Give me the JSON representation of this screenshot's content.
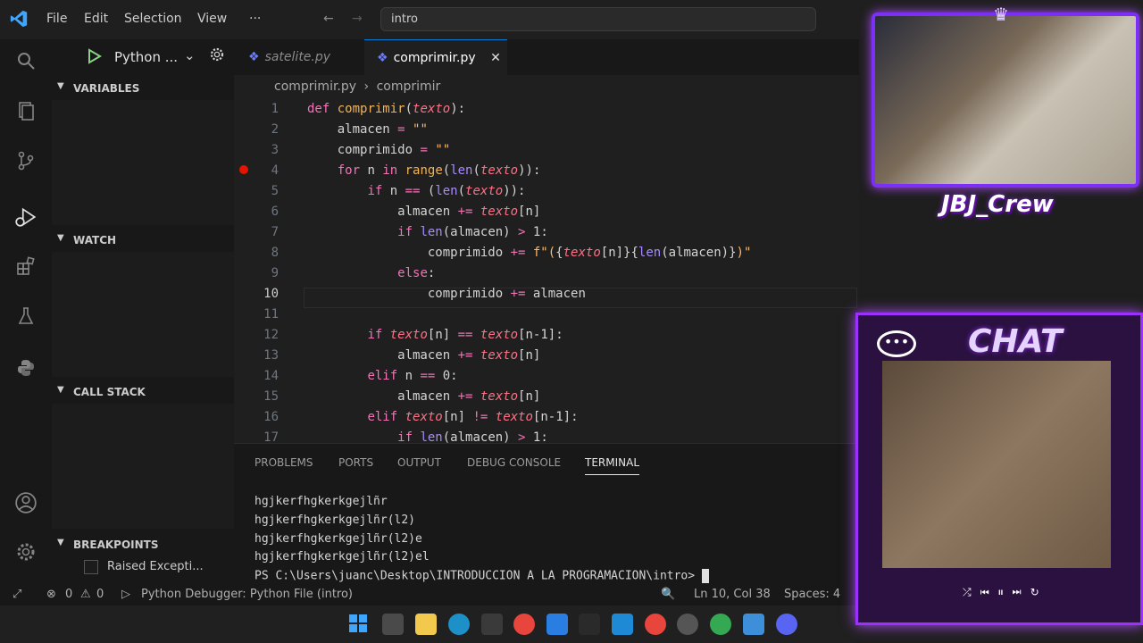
{
  "titlebar": {
    "menu": [
      "File",
      "Edit",
      "Selection",
      "View",
      "···"
    ],
    "search_value": "intro"
  },
  "debug": {
    "config_label": "Python ..."
  },
  "tabs": [
    {
      "label": "satelite.py",
      "active": false
    },
    {
      "label": "comprimir.py",
      "active": true
    }
  ],
  "breadcrumb": {
    "file": "comprimir.py",
    "symbol": "comprimir"
  },
  "sidebar": {
    "variables": "VARIABLES",
    "watch": "WATCH",
    "call_stack": "CALL STACK",
    "breakpoints": "BREAKPOINTS",
    "breakpoint_item": "Raised Excepti..."
  },
  "editor": {
    "current_line": 10,
    "breakpoint_line": 4,
    "line_numbers": [
      "1",
      "2",
      "3",
      "4",
      "5",
      "6",
      "7",
      "8",
      "9",
      "10",
      "11",
      "12",
      "13",
      "14",
      "15",
      "16",
      "17"
    ]
  },
  "panel": {
    "tabs": [
      "PROBLEMS",
      "PORTS",
      "OUTPUT",
      "DEBUG CONSOLE",
      "TERMINAL"
    ],
    "active_tab": "TERMINAL",
    "terminal_lines": [
      "hgjkerfhgkerkgejlñr",
      "hgjkerfhgkerkgejlñr(l2)",
      "hgjkerfhgkerkgejlñr(l2)e",
      "hgjkerfhgkerkgejlñr(l2)el",
      "PS C:\\Users\\juanc\\Desktop\\INTRODUCCION A LA PROGRAMACION\\intro> "
    ]
  },
  "statusbar": {
    "errors": "0",
    "warnings": "0",
    "debugger": "Python Debugger: Python File (intro)",
    "position": "Ln 10, Col 38",
    "spaces": "Spaces: 4"
  },
  "overlay": {
    "crew_name": "JBJ_Crew",
    "chat_title": "CHAT",
    "chat_bubble": "•••"
  },
  "colors": {
    "accent": "#0078d4",
    "breakpoint": "#e51400",
    "overlay_purple": "#9b30ff"
  }
}
